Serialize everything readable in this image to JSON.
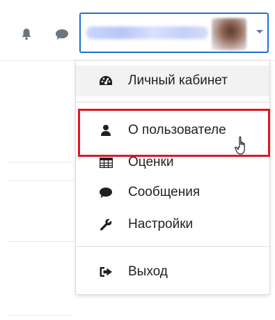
{
  "navbar": {
    "icons": {
      "notifications": "bell-icon",
      "messages": "chat-icon"
    },
    "user_menu": {
      "caret_icon": "caret-down-icon",
      "accent_color": "#1f6fd1"
    }
  },
  "dropdown": {
    "items": [
      {
        "icon": "dashboard-gauge-icon",
        "label": "Личный кабинет"
      },
      {
        "icon": "user-icon",
        "label": "О пользователе"
      },
      {
        "icon": "table-icon",
        "label": "Оценки"
      },
      {
        "icon": "comment-icon",
        "label": "Сообщения"
      },
      {
        "icon": "wrench-icon",
        "label": "Настройки"
      },
      {
        "icon": "sign-out-icon",
        "label": "Выход"
      }
    ],
    "highlight_color": "#e0161f"
  }
}
